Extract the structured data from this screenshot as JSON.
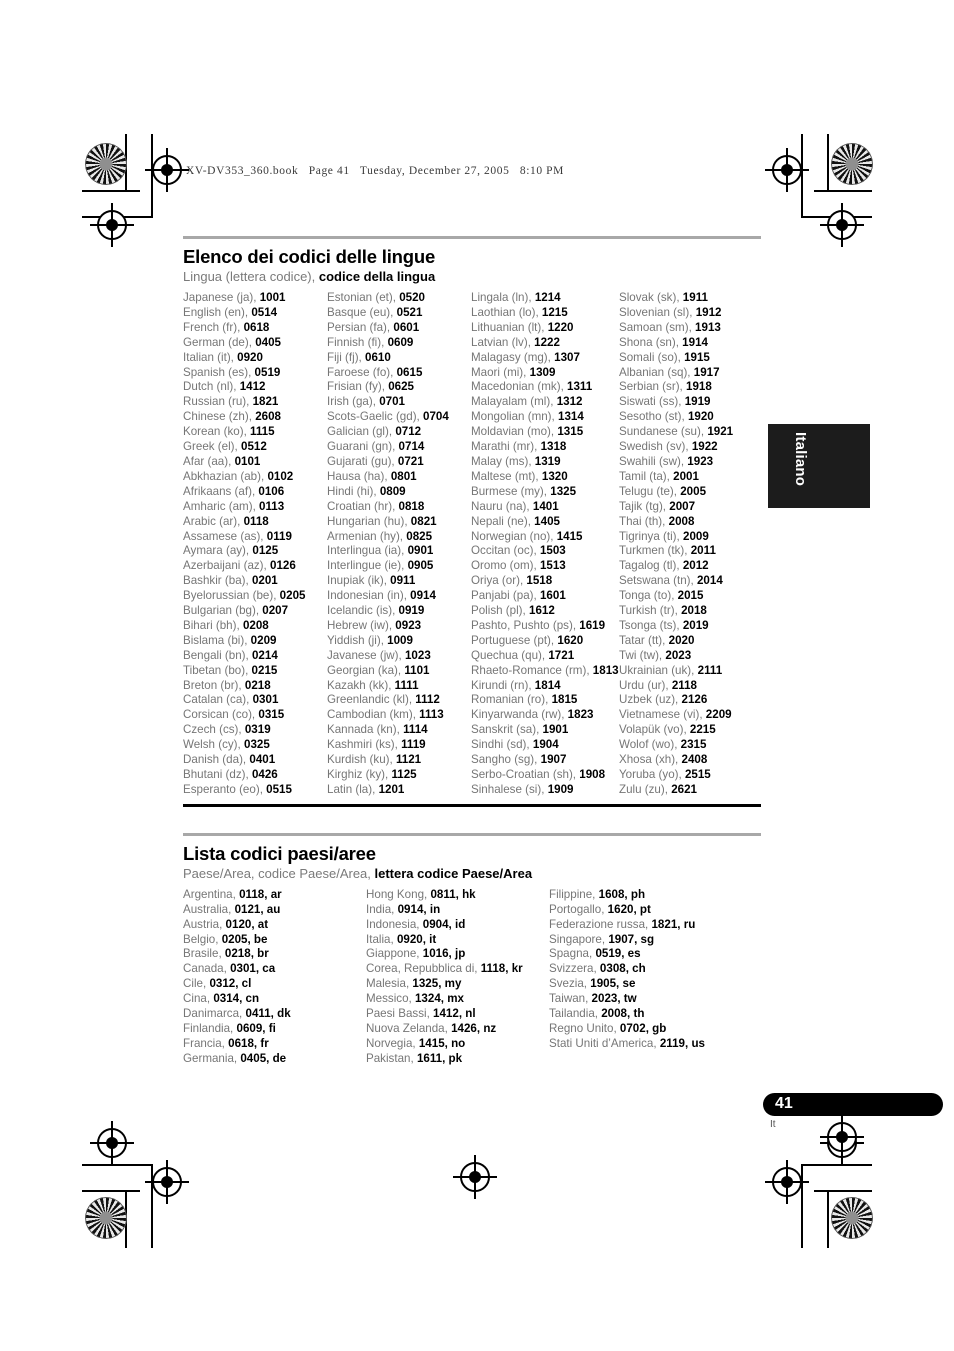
{
  "page_header": "XV-DV353_360.book   Page 41   Tuesday, December 27, 2005   8:10 PM",
  "side_tab": {
    "label": "Italiano"
  },
  "footer": {
    "page_number": "41",
    "language_mark": "It"
  },
  "colors": {
    "rule_gray": "#a8a8a8",
    "rule_black": "#000000",
    "body_text": "#767676",
    "emphasis_text": "#000000"
  },
  "sections": [
    {
      "title": "Elenco dei codici delle lingue",
      "subtitle_plain": "Lingua (lettera codice), ",
      "subtitle_bold": "codice della lingua",
      "columns": [
        [
          {
            "name": "Japanese (ja),",
            "code": "1001"
          },
          {
            "name": "English (en),",
            "code": "0514"
          },
          {
            "name": "French (fr),",
            "code": "0618"
          },
          {
            "name": "German (de),",
            "code": "0405"
          },
          {
            "name": "Italian (it),",
            "code": "0920"
          },
          {
            "name": "Spanish (es),",
            "code": "0519"
          },
          {
            "name": "Dutch (nl),",
            "code": "1412"
          },
          {
            "name": "Russian (ru),",
            "code": "1821"
          },
          {
            "name": "Chinese (zh),",
            "code": "2608"
          },
          {
            "name": "Korean (ko),",
            "code": "1115"
          },
          {
            "name": "Greek (el),",
            "code": "0512"
          },
          {
            "name": "Afar (aa),",
            "code": "0101"
          },
          {
            "name": "Abkhazian (ab),",
            "code": "0102"
          },
          {
            "name": "Afrikaans (af),",
            "code": "0106"
          },
          {
            "name": "Amharic (am),",
            "code": "0113"
          },
          {
            "name": "Arabic (ar),",
            "code": "0118"
          },
          {
            "name": "Assamese (as),",
            "code": "0119"
          },
          {
            "name": "Aymara (ay),",
            "code": "0125"
          },
          {
            "name": "Azerbaijani (az),",
            "code": "0126"
          },
          {
            "name": "Bashkir (ba),",
            "code": "0201"
          },
          {
            "name": "Byelorussian (be),",
            "code": "0205"
          },
          {
            "name": "Bulgarian (bg),",
            "code": "0207"
          },
          {
            "name": "Bihari (bh),",
            "code": "0208"
          },
          {
            "name": "Bislama (bi),",
            "code": "0209"
          },
          {
            "name": "Bengali (bn),",
            "code": "0214"
          },
          {
            "name": "Tibetan (bo),",
            "code": "0215"
          },
          {
            "name": "Breton (br),",
            "code": "0218"
          },
          {
            "name": "Catalan (ca),",
            "code": "0301"
          },
          {
            "name": "Corsican (co),",
            "code": "0315"
          },
          {
            "name": "Czech (cs),",
            "code": "0319"
          },
          {
            "name": "Welsh (cy),",
            "code": "0325"
          },
          {
            "name": "Danish (da),",
            "code": "0401"
          },
          {
            "name": "Bhutani (dz),",
            "code": "0426"
          },
          {
            "name": "Esperanto (eo),",
            "code": "0515"
          }
        ],
        [
          {
            "name": "Estonian (et),",
            "code": "0520"
          },
          {
            "name": "Basque (eu),",
            "code": "0521"
          },
          {
            "name": "Persian (fa),",
            "code": "0601"
          },
          {
            "name": "Finnish (fi),",
            "code": "0609"
          },
          {
            "name": "Fiji (fj),",
            "code": "0610"
          },
          {
            "name": "Faroese (fo),",
            "code": "0615"
          },
          {
            "name": "Frisian (fy),",
            "code": "0625"
          },
          {
            "name": "Irish (ga),",
            "code": "0701"
          },
          {
            "name": "Scots-Gaelic (gd),",
            "code": "0704"
          },
          {
            "name": "Galician (gl),",
            "code": "0712"
          },
          {
            "name": "Guarani (gn),",
            "code": "0714"
          },
          {
            "name": "Gujarati (gu),",
            "code": "0721"
          },
          {
            "name": "Hausa (ha),",
            "code": "0801"
          },
          {
            "name": "Hindi (hi),",
            "code": "0809"
          },
          {
            "name": "Croatian (hr),",
            "code": "0818"
          },
          {
            "name": "Hungarian (hu),",
            "code": "0821"
          },
          {
            "name": "Armenian (hy),",
            "code": "0825"
          },
          {
            "name": "Interlingua (ia),",
            "code": "0901"
          },
          {
            "name": "Interlingue (ie),",
            "code": "0905"
          },
          {
            "name": "Inupiak (ik),",
            "code": "0911"
          },
          {
            "name": "Indonesian (in),",
            "code": "0914"
          },
          {
            "name": "Icelandic (is),",
            "code": "0919"
          },
          {
            "name": "Hebrew (iw),",
            "code": "0923"
          },
          {
            "name": "Yiddish (ji),",
            "code": "1009"
          },
          {
            "name": "Javanese (jw),",
            "code": "1023"
          },
          {
            "name": "Georgian (ka),",
            "code": "1101"
          },
          {
            "name": "Kazakh (kk),",
            "code": "1111"
          },
          {
            "name": "Greenlandic (kl),",
            "code": "1112"
          },
          {
            "name": "Cambodian (km),",
            "code": "1113"
          },
          {
            "name": "Kannada (kn),",
            "code": "1114"
          },
          {
            "name": "Kashmiri (ks),",
            "code": "1119"
          },
          {
            "name": "Kurdish (ku),",
            "code": "1121"
          },
          {
            "name": "Kirghiz (ky),",
            "code": "1125"
          },
          {
            "name": "Latin (la),",
            "code": "1201"
          }
        ],
        [
          {
            "name": "Lingala (ln),",
            "code": "1214"
          },
          {
            "name": "Laothian (lo),",
            "code": "1215"
          },
          {
            "name": "Lithuanian (lt),",
            "code": "1220"
          },
          {
            "name": "Latvian (lv),",
            "code": "1222"
          },
          {
            "name": "Malagasy (mg),",
            "code": "1307"
          },
          {
            "name": "Maori (mi),",
            "code": "1309"
          },
          {
            "name": "Macedonian (mk),",
            "code": "1311"
          },
          {
            "name": "Malayalam (ml),",
            "code": "1312"
          },
          {
            "name": "Mongolian (mn),",
            "code": "1314"
          },
          {
            "name": "Moldavian (mo),",
            "code": "1315"
          },
          {
            "name": "Marathi (mr),",
            "code": "1318"
          },
          {
            "name": "Malay (ms),",
            "code": "1319"
          },
          {
            "name": "Maltese (mt),",
            "code": "1320"
          },
          {
            "name": "Burmese (my),",
            "code": "1325"
          },
          {
            "name": "Nauru (na),",
            "code": "1401"
          },
          {
            "name": "Nepali (ne),",
            "code": "1405"
          },
          {
            "name": "Norwegian (no),",
            "code": "1415"
          },
          {
            "name": "Occitan (oc),",
            "code": "1503"
          },
          {
            "name": "Oromo (om),",
            "code": "1513"
          },
          {
            "name": "Oriya (or),",
            "code": "1518"
          },
          {
            "name": "Panjabi (pa),",
            "code": "1601"
          },
          {
            "name": "Polish (pl),",
            "code": "1612"
          },
          {
            "name": "Pashto, Pushto (ps),",
            "code": "1619"
          },
          {
            "name": "Portuguese (pt),",
            "code": "1620"
          },
          {
            "name": "Quechua (qu),",
            "code": "1721"
          },
          {
            "name": "Rhaeto-Romance (rm),",
            "code": "1813"
          },
          {
            "name": "Kirundi (rn),",
            "code": "1814"
          },
          {
            "name": "Romanian (ro),",
            "code": "1815"
          },
          {
            "name": "Kinyarwanda (rw),",
            "code": "1823"
          },
          {
            "name": "Sanskrit (sa),",
            "code": "1901"
          },
          {
            "name": "Sindhi (sd),",
            "code": "1904"
          },
          {
            "name": "Sangho (sg),",
            "code": "1907"
          },
          {
            "name": "Serbo-Croatian (sh),",
            "code": "1908"
          },
          {
            "name": "Sinhalese (si),",
            "code": "1909"
          }
        ],
        [
          {
            "name": "Slovak (sk),",
            "code": "1911"
          },
          {
            "name": "Slovenian (sl),",
            "code": "1912"
          },
          {
            "name": "Samoan (sm),",
            "code": "1913"
          },
          {
            "name": "Shona (sn),",
            "code": "1914"
          },
          {
            "name": "Somali (so),",
            "code": "1915"
          },
          {
            "name": "Albanian (sq),",
            "code": "1917"
          },
          {
            "name": "Serbian (sr),",
            "code": "1918"
          },
          {
            "name": "Siswati (ss),",
            "code": "1919"
          },
          {
            "name": "Sesotho (st),",
            "code": "1920"
          },
          {
            "name": "Sundanese (su),",
            "code": "1921"
          },
          {
            "name": "Swedish (sv),",
            "code": "1922"
          },
          {
            "name": "Swahili (sw),",
            "code": "1923"
          },
          {
            "name": "Tamil (ta),",
            "code": "2001"
          },
          {
            "name": "Telugu (te),",
            "code": "2005"
          },
          {
            "name": "Tajik (tg),",
            "code": "2007"
          },
          {
            "name": "Thai (th),",
            "code": "2008"
          },
          {
            "name": "Tigrinya (ti),",
            "code": "2009"
          },
          {
            "name": "Turkmen (tk),",
            "code": "2011"
          },
          {
            "name": "Tagalog (tl),",
            "code": "2012"
          },
          {
            "name": "Setswana (tn),",
            "code": "2014"
          },
          {
            "name": "Tonga (to),",
            "code": "2015"
          },
          {
            "name": "Turkish (tr),",
            "code": "2018"
          },
          {
            "name": "Tsonga (ts),",
            "code": "2019"
          },
          {
            "name": "Tatar (tt),",
            "code": "2020"
          },
          {
            "name": "Twi (tw),",
            "code": "2023"
          },
          {
            "name": "Ukrainian (uk),",
            "code": "2111"
          },
          {
            "name": "Urdu (ur),",
            "code": "2118"
          },
          {
            "name": "Uzbek (uz),",
            "code": "2126"
          },
          {
            "name": "Vietnamese (vi),",
            "code": "2209"
          },
          {
            "name": "Volapük (vo),",
            "code": "2215"
          },
          {
            "name": "Wolof (wo),",
            "code": "2315"
          },
          {
            "name": "Xhosa (xh),",
            "code": "2408"
          },
          {
            "name": "Yoruba (yo),",
            "code": "2515"
          },
          {
            "name": "Zulu (zu),",
            "code": "2621"
          }
        ]
      ]
    },
    {
      "title": "Lista codici paesi/aree",
      "subtitle_plain": "Paese/Area, codice Paese/Area, ",
      "subtitle_bold": "lettera codice Paese/Area",
      "columns": [
        [
          {
            "name": "Argentina,",
            "code": "0118, ar"
          },
          {
            "name": "Australia,",
            "code": "0121, au"
          },
          {
            "name": "Austria,",
            "code": "0120, at"
          },
          {
            "name": "Belgio,",
            "code": "0205, be"
          },
          {
            "name": "Brasile,",
            "code": "0218, br"
          },
          {
            "name": "Canada,",
            "code": "0301, ca"
          },
          {
            "name": "Cile,",
            "code": "0312, cl"
          },
          {
            "name": "Cina,",
            "code": "0314, cn"
          },
          {
            "name": "Danimarca,",
            "code": "0411, dk"
          },
          {
            "name": "Finlandia,",
            "code": "0609, fi"
          },
          {
            "name": "Francia,",
            "code": "0618, fr"
          },
          {
            "name": "Germania,",
            "code": "0405, de"
          }
        ],
        [
          {
            "name": "Hong Kong,",
            "code": "0811, hk"
          },
          {
            "name": "India,",
            "code": "0914, in"
          },
          {
            "name": "Indonesia,",
            "code": "0904, id"
          },
          {
            "name": "Italia,",
            "code": "0920, it"
          },
          {
            "name": "Giappone,",
            "code": "1016, jp"
          },
          {
            "name": "Corea, Repubblica di,",
            "code": "1118, kr"
          },
          {
            "name": "Malesia,",
            "code": "1325, my"
          },
          {
            "name": "Messico,",
            "code": "1324, mx"
          },
          {
            "name": "Paesi Bassi,",
            "code": "1412, nl"
          },
          {
            "name": "Nuova Zelanda,",
            "code": "1426, nz"
          },
          {
            "name": "Norvegia,",
            "code": "1415, no"
          },
          {
            "name": "Pakistan,",
            "code": "1611, pk"
          }
        ],
        [
          {
            "name": "Filippine,",
            "code": "1608, ph"
          },
          {
            "name": "Portogallo,",
            "code": "1620, pt"
          },
          {
            "name": "Federazione russa,",
            "code": "1821, ru"
          },
          {
            "name": "Singapore,",
            "code": "1907, sg"
          },
          {
            "name": "Spagna,",
            "code": "0519, es"
          },
          {
            "name": "Svizzera,",
            "code": "0308, ch"
          },
          {
            "name": "Svezia,",
            "code": "1905, se"
          },
          {
            "name": "Taiwan,",
            "code": "2023, tw"
          },
          {
            "name": "Tailandia,",
            "code": "2008, th"
          },
          {
            "name": "Regno Unito,",
            "code": "0702, gb"
          },
          {
            "name": "Stati Uniti d’America,",
            "code": "2119, us"
          }
        ]
      ]
    }
  ]
}
